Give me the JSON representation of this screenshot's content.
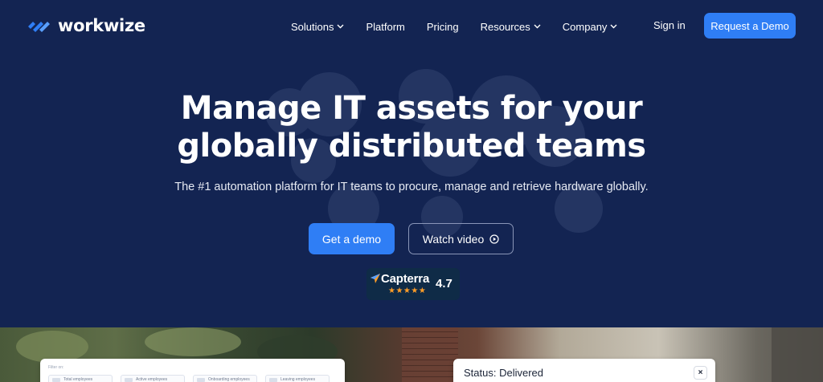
{
  "brand": {
    "name": "workwize",
    "logo_icon": "workwize-logo-icon",
    "accent_color": "#2f7ef5",
    "background_color": "#132452"
  },
  "nav": {
    "items": [
      {
        "label": "Solutions",
        "has_dropdown": true
      },
      {
        "label": "Platform",
        "has_dropdown": false
      },
      {
        "label": "Pricing",
        "has_dropdown": false
      },
      {
        "label": "Resources",
        "has_dropdown": true
      },
      {
        "label": "Company",
        "has_dropdown": true
      }
    ],
    "sign_in": "Sign in",
    "request_demo": "Request a Demo"
  },
  "hero": {
    "headline_line1": "Manage IT assets for your",
    "headline_line2": "globally distributed teams",
    "subheadline": "The #1 automation platform for IT teams to procure, manage and retrieve hardware globally.",
    "primary_cta": "Get a demo",
    "secondary_cta": "Watch video",
    "secondary_cta_icon": "play-circle-icon"
  },
  "rating": {
    "platform": "Capterra",
    "score": "4.7",
    "stars": "★★★★★",
    "stars_value": 4.7,
    "star_color": "#ff9d28"
  },
  "status_card": {
    "text": "Status: Delivered",
    "close_label": "×"
  },
  "filter_card": {
    "label": "Filter on:",
    "filters": [
      "Total employees",
      "Active employees",
      "Onboarding employees",
      "Leaving employees"
    ]
  }
}
